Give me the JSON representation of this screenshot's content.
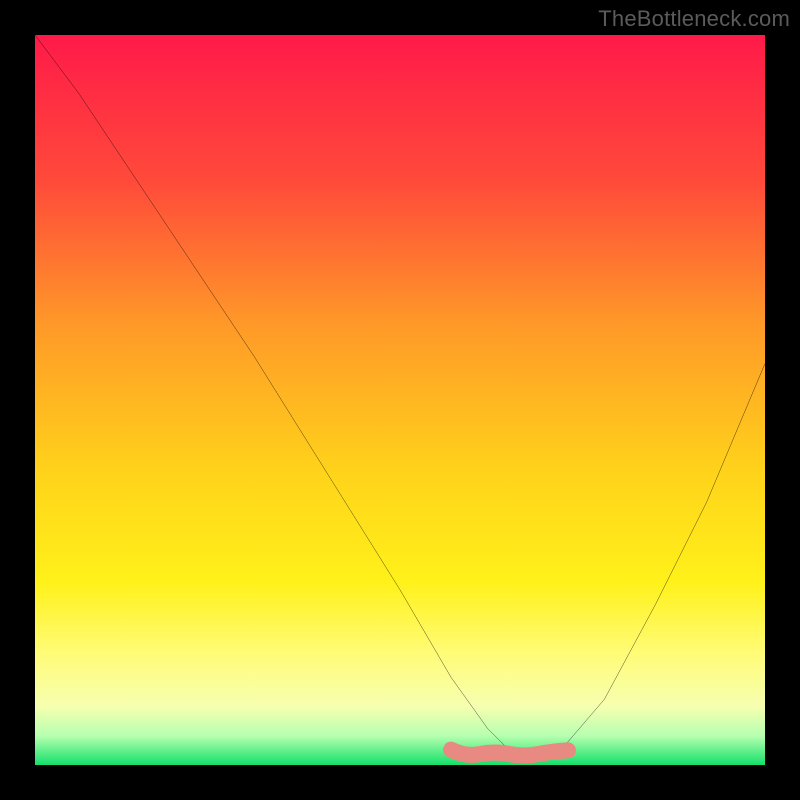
{
  "watermark": "TheBottleneck.com",
  "chart_data": {
    "type": "line",
    "title": "",
    "xlabel": "",
    "ylabel": "",
    "xlim": [
      0,
      100
    ],
    "ylim": [
      0,
      100
    ],
    "grid": false,
    "background_gradient": {
      "stops": [
        {
          "pos": 0.0,
          "color": "#ff1a49"
        },
        {
          "pos": 0.2,
          "color": "#ff4a3a"
        },
        {
          "pos": 0.4,
          "color": "#ff9a28"
        },
        {
          "pos": 0.6,
          "color": "#ffd31a"
        },
        {
          "pos": 0.75,
          "color": "#fff11a"
        },
        {
          "pos": 0.85,
          "color": "#fffc7a"
        },
        {
          "pos": 0.92,
          "color": "#f6ffb0"
        },
        {
          "pos": 0.96,
          "color": "#b6ffb0"
        },
        {
          "pos": 1.0,
          "color": "#14e06a"
        }
      ]
    },
    "series": [
      {
        "name": "bottleneck-curve",
        "stroke": "#000000",
        "x": [
          0,
          6,
          12,
          20,
          30,
          40,
          50,
          57,
          62,
          65,
          72,
          78,
          85,
          92,
          100
        ],
        "y": [
          100,
          92,
          83,
          71,
          56,
          40,
          24,
          12,
          5,
          2,
          2,
          9,
          22,
          36,
          55
        ]
      }
    ],
    "flat_marker": {
      "name": "optimal-range",
      "color": "#e98a82",
      "x_range": [
        57,
        73
      ],
      "y": 1.5,
      "thickness": 2.2
    }
  }
}
